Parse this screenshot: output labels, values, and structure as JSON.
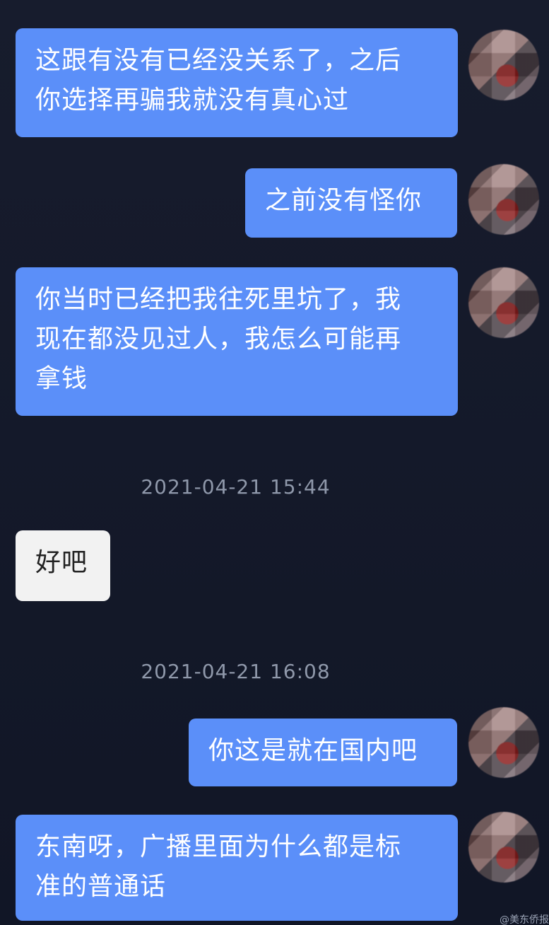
{
  "messages": [
    {
      "text": "这跟有没有已经没关系了，之后\n你选择再骗我就没有真心过"
    },
    {
      "text": "之前没有怪你"
    },
    {
      "text": "你当时已经把我往死里坑了，我\n现在都没见过人，我怎么可能再\n拿钱"
    },
    {
      "text": "好吧"
    },
    {
      "text": "你这是就在国内吧"
    },
    {
      "text": "东南呀，广播里面为什么都是标\n准的普通话"
    }
  ],
  "timestamps": [
    {
      "text": "2021-04-21 15:44"
    },
    {
      "text": "2021-04-21 16:08"
    }
  ],
  "watermark": {
    "text": "@美东侨报"
  },
  "colors": {
    "background": "#151a2b",
    "outgoing_bubble": "#5b8ff9",
    "incoming_bubble": "#f2f2f2",
    "timestamp_text": "#8f98aa"
  }
}
